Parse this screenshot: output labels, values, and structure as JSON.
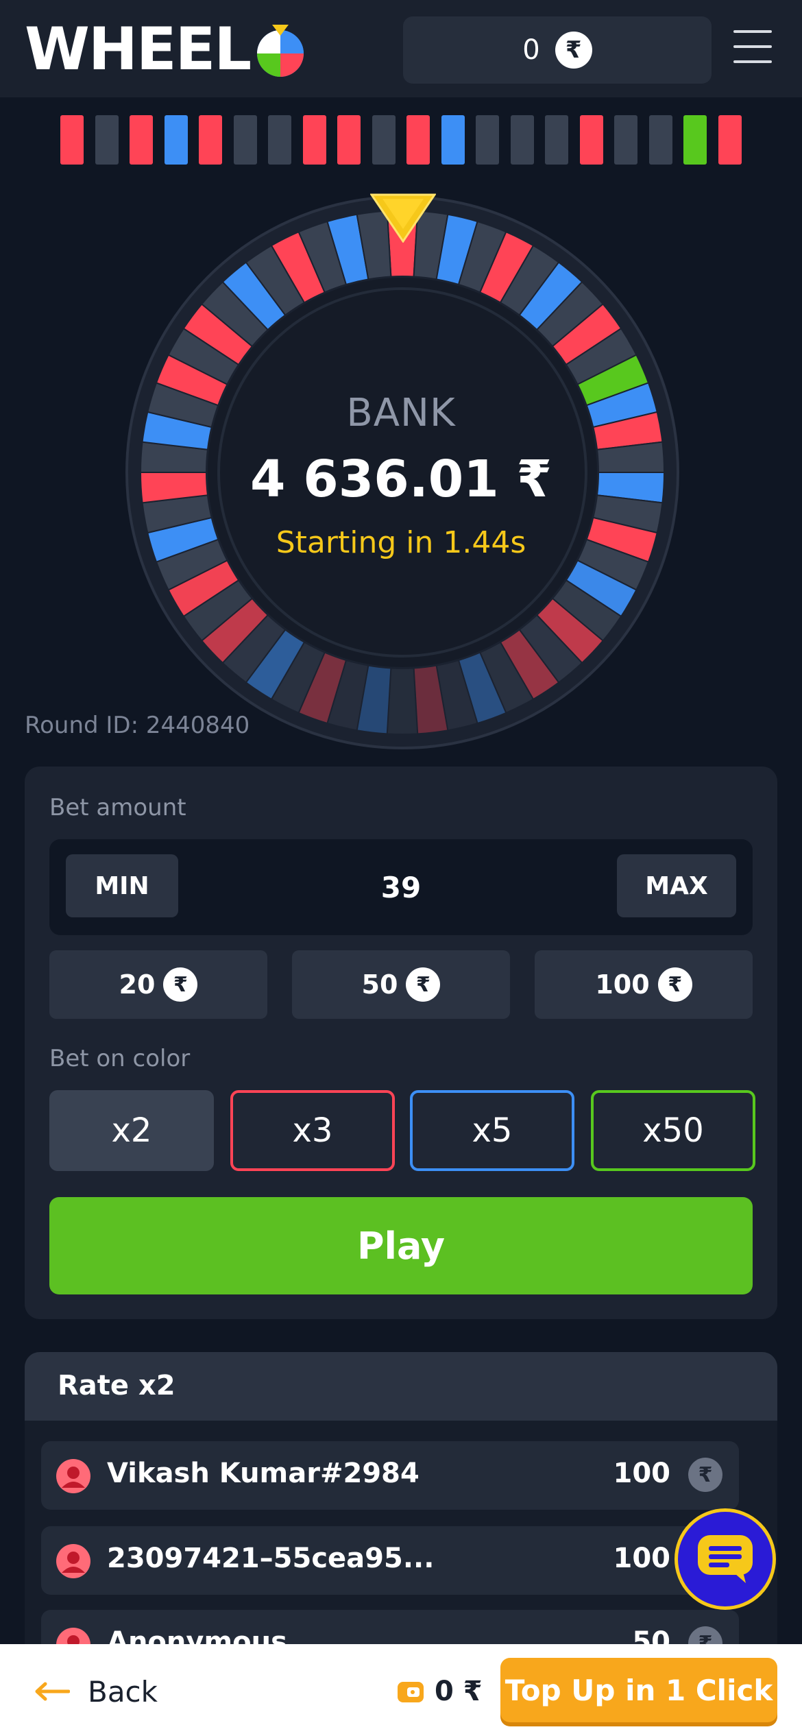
{
  "header": {
    "logo_text": "WHEEL",
    "balance": "0",
    "currency_symbol": "₹"
  },
  "history": [
    "red",
    "gray",
    "red",
    "blue",
    "red",
    "gray",
    "gray",
    "red",
    "red",
    "gray",
    "red",
    "blue",
    "gray",
    "gray",
    "gray",
    "red",
    "gray",
    "gray",
    "green",
    "red"
  ],
  "colors": {
    "red": "#ff4456",
    "blue": "#3d8ff5",
    "green": "#58c81e",
    "gray": "#394252",
    "accent_yellow": "#f6c81a",
    "play_green": "#5cc022",
    "topup_orange": "#f8a71c"
  },
  "wheel": {
    "segments": [
      "red",
      "gray",
      "blue",
      "gray",
      "red",
      "gray",
      "blue",
      "gray",
      "red",
      "gray",
      "green",
      "blue",
      "red",
      "gray",
      "blue",
      "gray",
      "red",
      "gray",
      "blue",
      "gray",
      "red",
      "gray",
      "red",
      "gray",
      "blue",
      "gray",
      "red",
      "gray",
      "blue",
      "gray",
      "red",
      "gray",
      "blue",
      "gray",
      "red",
      "gray",
      "red",
      "gray",
      "blue",
      "gray",
      "red",
      "gray",
      "blue",
      "gray",
      "red",
      "gray",
      "red",
      "gray",
      "blue",
      "gray",
      "red",
      "gray",
      "blue",
      "gray"
    ],
    "bank_label": "BANK",
    "bank_amount": "4 636.01 ₹",
    "status": "Starting in 1.44s"
  },
  "round": {
    "label": "Round ID: 2440840"
  },
  "bet": {
    "amount_label": "Bet amount",
    "min_label": "MIN",
    "max_label": "MAX",
    "amount_value": "39",
    "quick_amounts": [
      "20",
      "50",
      "100"
    ],
    "color_label": "Bet on color",
    "color_options": [
      {
        "label": "x2",
        "color": "gray"
      },
      {
        "label": "x3",
        "color": "red"
      },
      {
        "label": "x5",
        "color": "blue"
      },
      {
        "label": "x50",
        "color": "green"
      }
    ],
    "play_label": "Play"
  },
  "rate": {
    "title": "Rate x2",
    "rows": [
      {
        "name": "Vikash Kumar#2984",
        "amount": "100"
      },
      {
        "name": "23097421–55cea95...",
        "amount": "100"
      },
      {
        "name": "Anonymous",
        "amount": "50"
      }
    ]
  },
  "bottom": {
    "back_label": "Back",
    "balance": "0 ₹",
    "topup_label": "Top Up in 1 Click"
  }
}
